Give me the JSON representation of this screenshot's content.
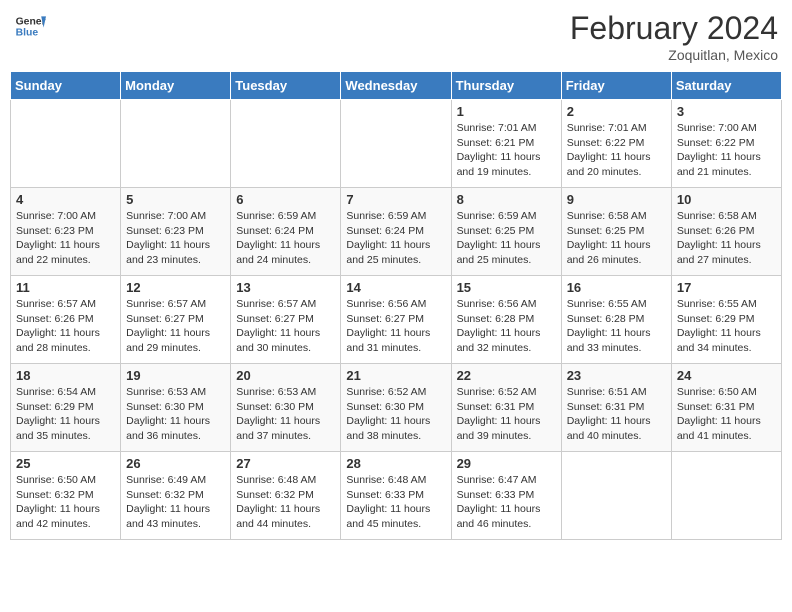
{
  "logo": {
    "line1": "General",
    "line2": "Blue"
  },
  "title": "February 2024",
  "location": "Zoquitlan, Mexico",
  "days_of_week": [
    "Sunday",
    "Monday",
    "Tuesday",
    "Wednesday",
    "Thursday",
    "Friday",
    "Saturday"
  ],
  "weeks": [
    [
      {
        "day": "",
        "info": ""
      },
      {
        "day": "",
        "info": ""
      },
      {
        "day": "",
        "info": ""
      },
      {
        "day": "",
        "info": ""
      },
      {
        "day": "1",
        "info": "Sunrise: 7:01 AM\nSunset: 6:21 PM\nDaylight: 11 hours and 19 minutes."
      },
      {
        "day": "2",
        "info": "Sunrise: 7:01 AM\nSunset: 6:22 PM\nDaylight: 11 hours and 20 minutes."
      },
      {
        "day": "3",
        "info": "Sunrise: 7:00 AM\nSunset: 6:22 PM\nDaylight: 11 hours and 21 minutes."
      }
    ],
    [
      {
        "day": "4",
        "info": "Sunrise: 7:00 AM\nSunset: 6:23 PM\nDaylight: 11 hours and 22 minutes."
      },
      {
        "day": "5",
        "info": "Sunrise: 7:00 AM\nSunset: 6:23 PM\nDaylight: 11 hours and 23 minutes."
      },
      {
        "day": "6",
        "info": "Sunrise: 6:59 AM\nSunset: 6:24 PM\nDaylight: 11 hours and 24 minutes."
      },
      {
        "day": "7",
        "info": "Sunrise: 6:59 AM\nSunset: 6:24 PM\nDaylight: 11 hours and 25 minutes."
      },
      {
        "day": "8",
        "info": "Sunrise: 6:59 AM\nSunset: 6:25 PM\nDaylight: 11 hours and 25 minutes."
      },
      {
        "day": "9",
        "info": "Sunrise: 6:58 AM\nSunset: 6:25 PM\nDaylight: 11 hours and 26 minutes."
      },
      {
        "day": "10",
        "info": "Sunrise: 6:58 AM\nSunset: 6:26 PM\nDaylight: 11 hours and 27 minutes."
      }
    ],
    [
      {
        "day": "11",
        "info": "Sunrise: 6:57 AM\nSunset: 6:26 PM\nDaylight: 11 hours and 28 minutes."
      },
      {
        "day": "12",
        "info": "Sunrise: 6:57 AM\nSunset: 6:27 PM\nDaylight: 11 hours and 29 minutes."
      },
      {
        "day": "13",
        "info": "Sunrise: 6:57 AM\nSunset: 6:27 PM\nDaylight: 11 hours and 30 minutes."
      },
      {
        "day": "14",
        "info": "Sunrise: 6:56 AM\nSunset: 6:27 PM\nDaylight: 11 hours and 31 minutes."
      },
      {
        "day": "15",
        "info": "Sunrise: 6:56 AM\nSunset: 6:28 PM\nDaylight: 11 hours and 32 minutes."
      },
      {
        "day": "16",
        "info": "Sunrise: 6:55 AM\nSunset: 6:28 PM\nDaylight: 11 hours and 33 minutes."
      },
      {
        "day": "17",
        "info": "Sunrise: 6:55 AM\nSunset: 6:29 PM\nDaylight: 11 hours and 34 minutes."
      }
    ],
    [
      {
        "day": "18",
        "info": "Sunrise: 6:54 AM\nSunset: 6:29 PM\nDaylight: 11 hours and 35 minutes."
      },
      {
        "day": "19",
        "info": "Sunrise: 6:53 AM\nSunset: 6:30 PM\nDaylight: 11 hours and 36 minutes."
      },
      {
        "day": "20",
        "info": "Sunrise: 6:53 AM\nSunset: 6:30 PM\nDaylight: 11 hours and 37 minutes."
      },
      {
        "day": "21",
        "info": "Sunrise: 6:52 AM\nSunset: 6:30 PM\nDaylight: 11 hours and 38 minutes."
      },
      {
        "day": "22",
        "info": "Sunrise: 6:52 AM\nSunset: 6:31 PM\nDaylight: 11 hours and 39 minutes."
      },
      {
        "day": "23",
        "info": "Sunrise: 6:51 AM\nSunset: 6:31 PM\nDaylight: 11 hours and 40 minutes."
      },
      {
        "day": "24",
        "info": "Sunrise: 6:50 AM\nSunset: 6:31 PM\nDaylight: 11 hours and 41 minutes."
      }
    ],
    [
      {
        "day": "25",
        "info": "Sunrise: 6:50 AM\nSunset: 6:32 PM\nDaylight: 11 hours and 42 minutes."
      },
      {
        "day": "26",
        "info": "Sunrise: 6:49 AM\nSunset: 6:32 PM\nDaylight: 11 hours and 43 minutes."
      },
      {
        "day": "27",
        "info": "Sunrise: 6:48 AM\nSunset: 6:32 PM\nDaylight: 11 hours and 44 minutes."
      },
      {
        "day": "28",
        "info": "Sunrise: 6:48 AM\nSunset: 6:33 PM\nDaylight: 11 hours and 45 minutes."
      },
      {
        "day": "29",
        "info": "Sunrise: 6:47 AM\nSunset: 6:33 PM\nDaylight: 11 hours and 46 minutes."
      },
      {
        "day": "",
        "info": ""
      },
      {
        "day": "",
        "info": ""
      }
    ]
  ]
}
